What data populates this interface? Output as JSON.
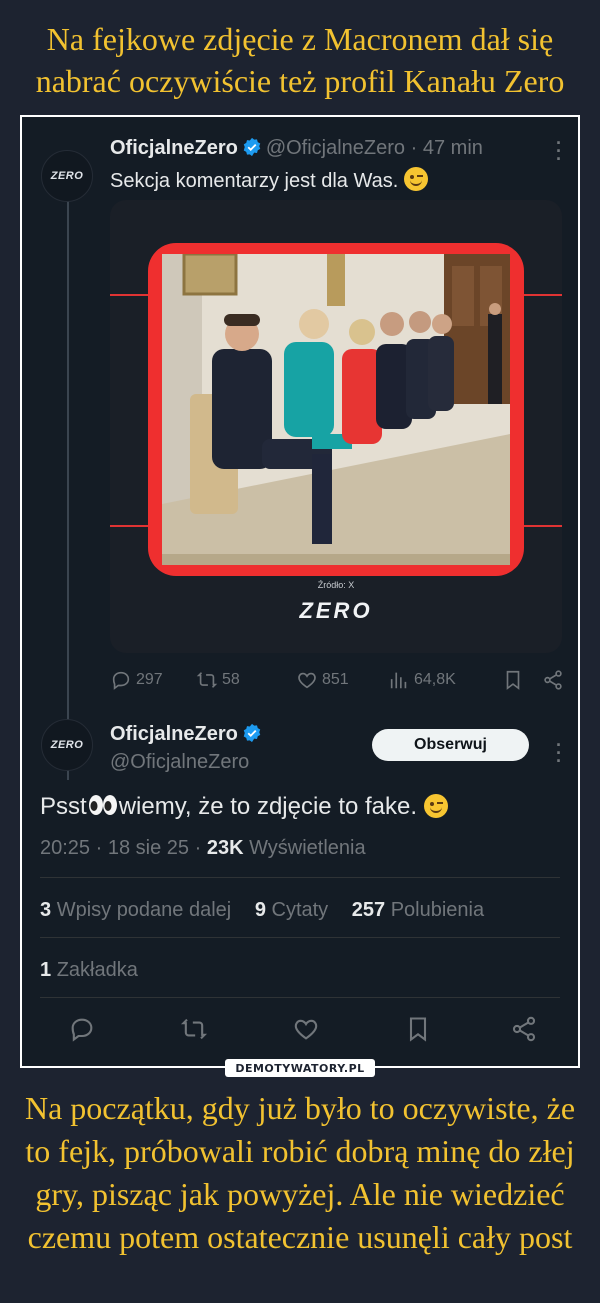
{
  "meme": {
    "headline": "Na fejkowe zdjęcie z Macronem dał się nabrać oczywiście też profil Kanału Zero",
    "caption": "Na początku, gdy już było to oczywiste, że to fejk, próbowali robić dobrą minę do złej gry, pisząc jak powyżej. Ale nie wiedzieć czemu potem ostatecznie usunęli cały post",
    "badge": "DEMOTYWATORY.PL"
  },
  "tweet1": {
    "avatar_text": "ZERO",
    "name": "OficjalneZero",
    "handle": "@OficjalneZero",
    "separator": "·",
    "time": "47 min",
    "text": "Sekcja komentarzy jest dla Was.",
    "emoji": "winking-face",
    "media": {
      "source_label": "Źródło: X",
      "logo_text": "ZERO"
    },
    "actions": {
      "replies": "297",
      "reposts": "58",
      "likes": "851",
      "views": "64,8K"
    }
  },
  "tweet2": {
    "avatar_text": "ZERO",
    "name": "OficjalneZero",
    "handle": "@OficjalneZero",
    "follow_label": "Obserwuj",
    "text_prefix": "Psst",
    "text_suffix": "wiemy, że to zdjęcie to fake.",
    "time": "20:25",
    "date": "18 sie 25",
    "views_count": "23K",
    "views_label": "Wyświetlenia",
    "reposts_count": "3",
    "reposts_label": "Wpisy podane dalej",
    "quotes_count": "9",
    "quotes_label": "Cytaty",
    "likes_count": "257",
    "likes_label": "Polubienia",
    "bookmarks_count": "1",
    "bookmarks_label": "Zakładka"
  },
  "colors": {
    "headline": "#f2c230",
    "background": "#1d2330",
    "tweet_bg": "#141c25",
    "verified": "#1d9bf0",
    "media_frame": "#ef2f2f"
  }
}
